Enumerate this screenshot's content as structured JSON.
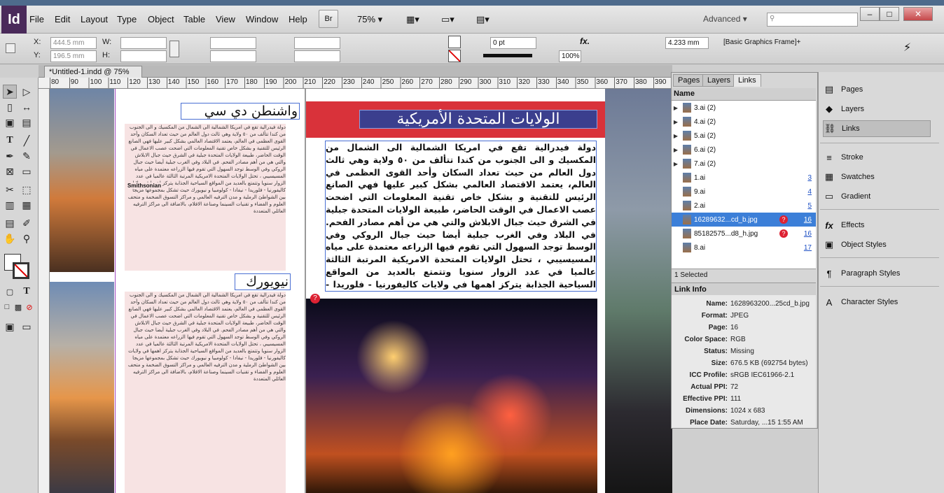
{
  "app": {
    "logo": "Id"
  },
  "menu": [
    "File",
    "Edit",
    "Layout",
    "Type",
    "Object",
    "Table",
    "View",
    "Window",
    "Help"
  ],
  "toolbar_top": {
    "bridge": "Br",
    "zoom": "75%",
    "workspace": "Advanced"
  },
  "control": {
    "x_label": "X:",
    "x_value": "444.5 mm",
    "y_label": "Y:",
    "y_value": "196.5 mm",
    "w_label": "W:",
    "h_label": "H:",
    "stroke_weight": "0 pt",
    "opacity": "100%",
    "dimension": "4.233 mm",
    "frame_style": "[Basic Graphics Frame]+"
  },
  "document": {
    "tab_title": "*Untitled-1.indd @ 75%"
  },
  "ruler": {
    "ticks": [
      "80",
      "90",
      "100",
      "110",
      "120",
      "130",
      "140",
      "150",
      "160",
      "170",
      "180",
      "190",
      "200",
      "210",
      "220",
      "230",
      "240",
      "250",
      "260",
      "270",
      "280",
      "290",
      "300",
      "310",
      "320",
      "330",
      "340",
      "350",
      "360",
      "370",
      "380",
      "390"
    ]
  },
  "page": {
    "heading_dc": "واشنطن دي سي",
    "heading_ny": "نيويورك",
    "banner_title": "الولايات المتحدة الأمريكية",
    "smithsonian": "Smithsonian",
    "body_text": "دولة فيدرالية تقع في امريكا الشمالية الى الشمال من المكسيك و الى الجنوب من كندا تتألف من ٥٠ ولاية وهي ثالث دول العالم من حيث تعداد السكان وأحد القوى العظمى في العالم، يعتمد الاقتصاد العالمي بشكل كبير عليها فهي الصانع الرئيس للتقنية و بشكل خاص تقنية المعلومات التي اضحت عصب الاعمال في الوقت الحاضر، طبيعة الولايات المتحدة جبلية في الشرق حيث جبال الابلاش والتي هي من أهم مصادر الفحم. في البلاد وفي الغرب جبلية أيضا حيث جبال الروكي وفي الوسط توجد السهول التي تقوم فيها الزراعه معتمدة على مياه المسيسيبي ، تحتل الولايات المتحدة الامريكية المرتبة الثالثة عالميا في عدد الزوار سنويا وتتمتع بالعديد من المواقع السياحية الجذابة يتركز اهمها في ولايات كاليفورنيا - فلوريدا - نيفادا - كولومبيا و نيويورك حيث تشكل بمجموعها مزيجا بين الشواطئ الرملية و مدن الترفيه العالمي و مراكز التسوق الضخمة و متحف العلوم و الفضاء و تقنيات السينما وصناعة الافلام، بالاضافة الى مراكز الترفيه العائلي المتعددة"
  },
  "panel": {
    "tabs": [
      "Pages",
      "Layers",
      "Links"
    ],
    "column_name": "Name",
    "links": [
      {
        "name": "3.ai (2)",
        "page": ""
      },
      {
        "name": "4.ai (2)",
        "page": ""
      },
      {
        "name": "5.ai (2)",
        "page": ""
      },
      {
        "name": "6.ai (2)",
        "page": ""
      },
      {
        "name": "7.ai (2)",
        "page": ""
      },
      {
        "name": "1.ai",
        "page": "3"
      },
      {
        "name": "9.ai",
        "page": "4"
      },
      {
        "name": "2.ai",
        "page": "5"
      },
      {
        "name": "16289632...cd_b.jpg",
        "page": "16"
      },
      {
        "name": "85182575...d8_h.jpg",
        "page": "16"
      },
      {
        "name": "8.ai",
        "page": "17"
      }
    ],
    "selected_count": "1 Selected",
    "link_info_title": "Link Info",
    "info": [
      {
        "label": "Name:",
        "value": "1628963200...25cd_b.jpg"
      },
      {
        "label": "Format:",
        "value": "JPEG"
      },
      {
        "label": "Page:",
        "value": "16"
      },
      {
        "label": "Color Space:",
        "value": "RGB"
      },
      {
        "label": "Status:",
        "value": "Missing"
      },
      {
        "label": "Size:",
        "value": "676.5 KB (692754 bytes)"
      },
      {
        "label": "ICC Profile:",
        "value": "sRGB IEC61966-2.1"
      },
      {
        "label": "Actual PPI:",
        "value": "72"
      },
      {
        "label": "Effective PPI:",
        "value": "111"
      },
      {
        "label": "Dimensions:",
        "value": "1024 x 683"
      },
      {
        "label": "Place Date:",
        "value": "Saturday, ...15 1:55 AM"
      }
    ]
  },
  "dock": [
    "Pages",
    "Layers",
    "Links",
    "Stroke",
    "Swatches",
    "Gradient",
    "Effects",
    "Object Styles",
    "Paragraph Styles",
    "Character Styles"
  ],
  "colors": {
    "banner": "#d9323a",
    "banner_text_bg": "#3b3f8e",
    "selection": "#3c7fd8"
  }
}
